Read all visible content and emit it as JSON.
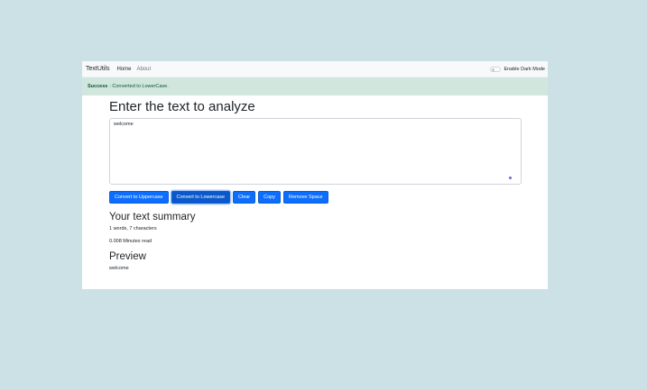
{
  "navbar": {
    "brand": "TextUtils",
    "links": [
      {
        "label": "Home"
      },
      {
        "label": "About"
      }
    ],
    "dark_mode_label": "Enable Dark Mode"
  },
  "alert": {
    "type": "Success",
    "prefix": "Success",
    "message": ": Converted to LowerCase."
  },
  "main": {
    "heading": "Enter the text to analyze",
    "textarea_value": "welcome",
    "buttons": [
      {
        "label": "Convert to Uppercase"
      },
      {
        "label": "Convert to Lowercase"
      },
      {
        "label": "Clear"
      },
      {
        "label": "Copy"
      },
      {
        "label": "Remove Space"
      }
    ]
  },
  "summary": {
    "heading": "Your text summary",
    "counts": "1 words, 7 characters",
    "read_time": "0.008 Minutes read"
  },
  "preview": {
    "heading": "Preview",
    "text": "welcome"
  },
  "colors": {
    "background": "#cce1e5",
    "primary": "#0d6efd",
    "alert_bg": "#d1e7dd",
    "alert_text": "#0f5132"
  }
}
